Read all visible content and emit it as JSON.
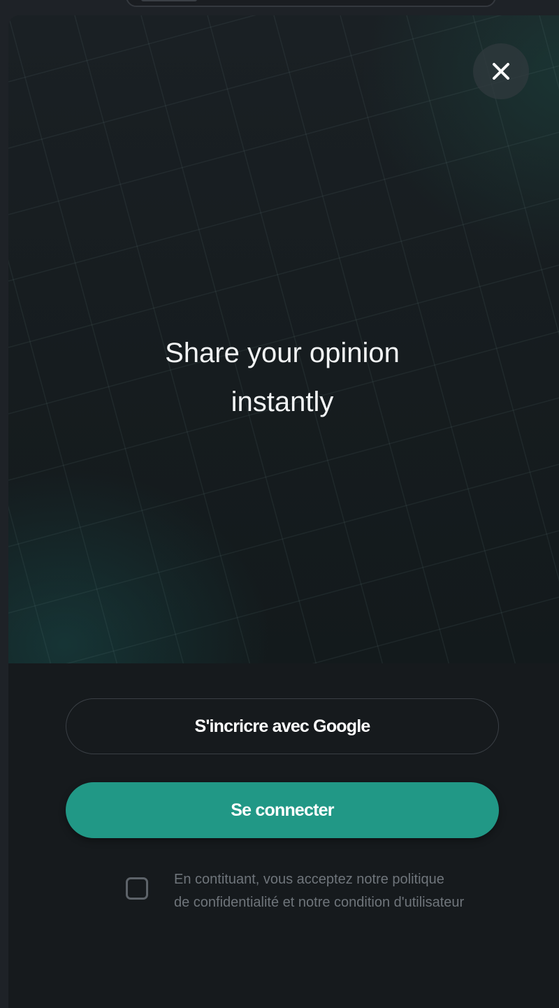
{
  "modal": {
    "headline_line1": "Share your opinion",
    "headline_line2": "instantly",
    "close_icon": "close-icon"
  },
  "actions": {
    "google_label": "S'incricre avec Google",
    "connect_label": "Se connecter"
  },
  "consent": {
    "checked": false,
    "line1": "En contituant, vous acceptez notre politique",
    "line2": "de confidentialité et notre condition d'utilisateur"
  },
  "colors": {
    "background": "#161a1d",
    "primary_button": "#219886",
    "headline_text": "#f2f4f5",
    "muted_text": "#6f757b"
  }
}
